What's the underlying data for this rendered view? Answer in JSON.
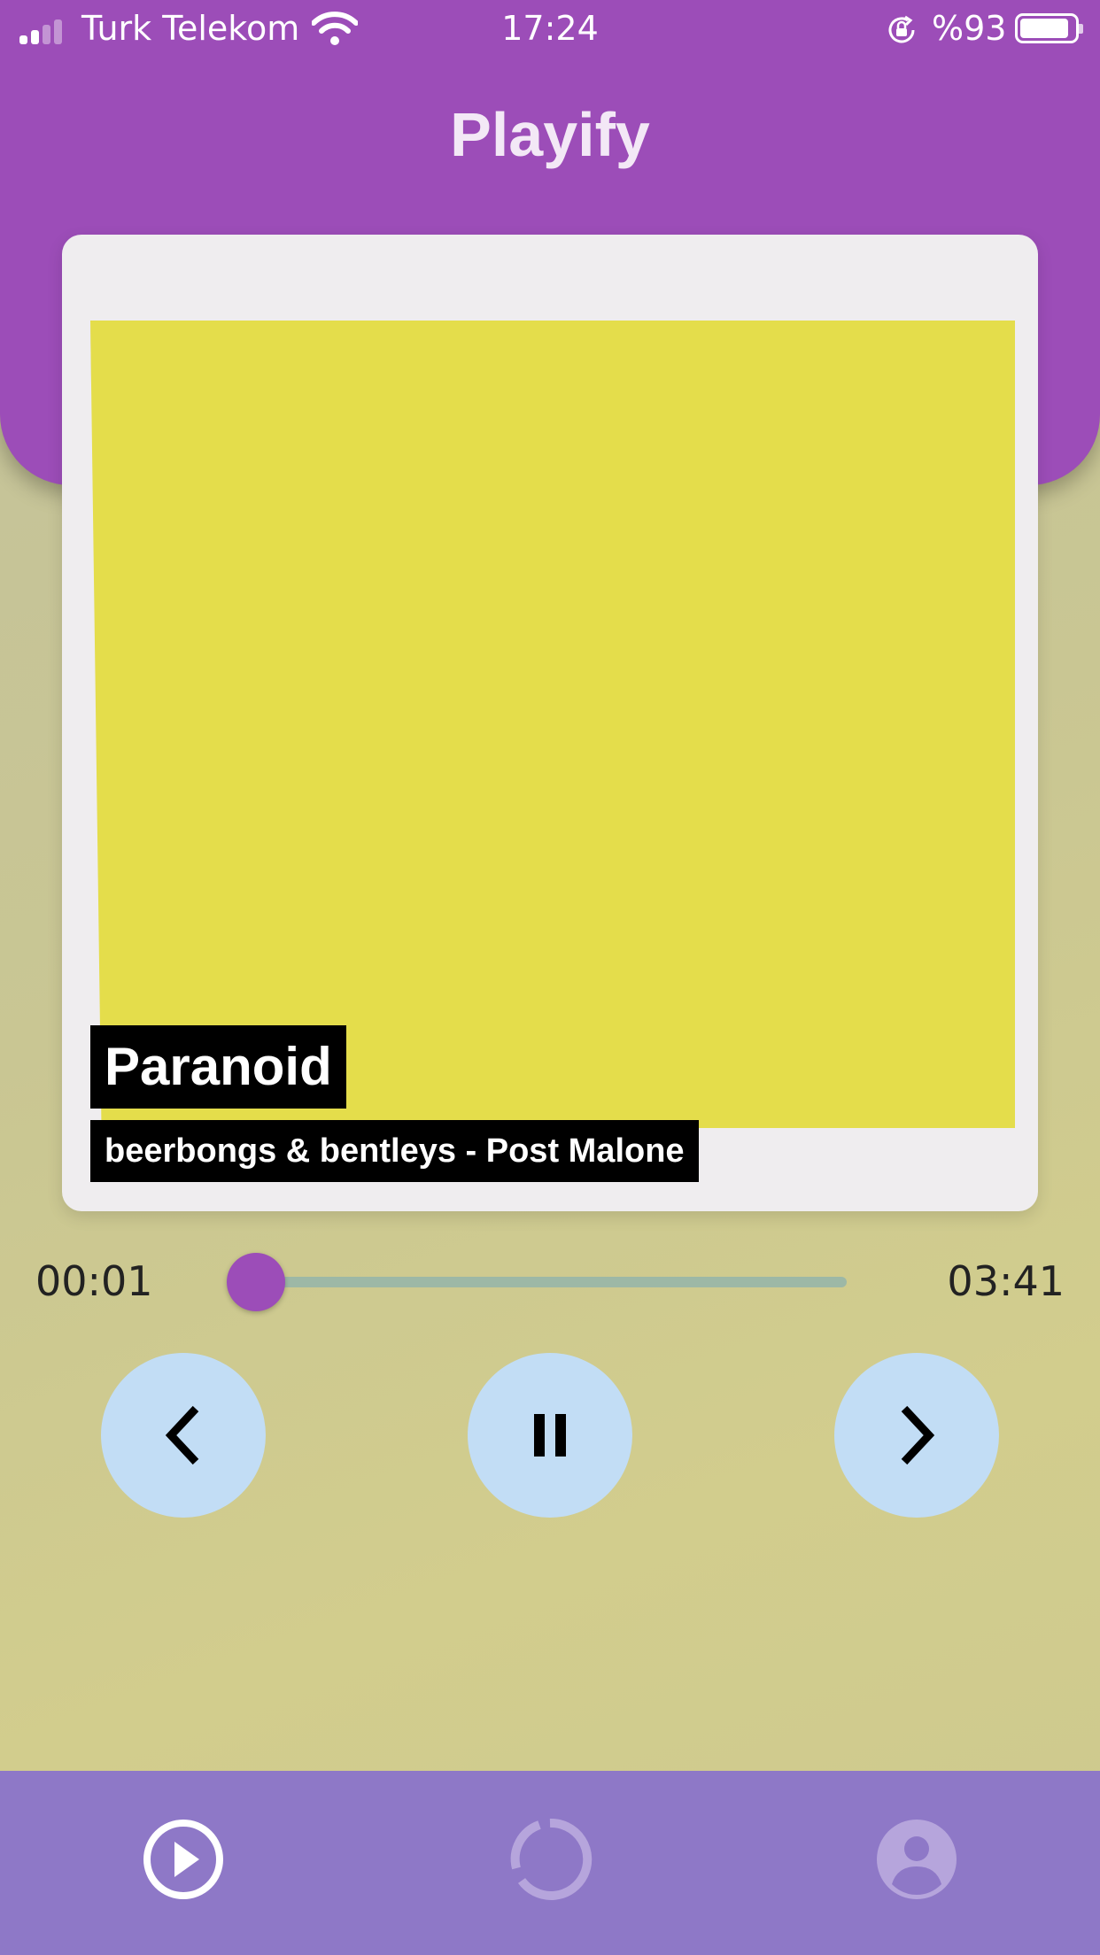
{
  "status_bar": {
    "carrier": "Turk Telekom",
    "time": "17:24",
    "battery_text": "%93",
    "signal_icon": "cellular-signal-icon",
    "wifi_icon": "wifi-icon",
    "orientation_lock_icon": "orientation-lock-icon",
    "battery_icon": "battery-icon",
    "battery_level": 0.93
  },
  "header": {
    "title": "Playify",
    "color": "#9c4db8"
  },
  "now_playing": {
    "title": "Paranoid",
    "subtitle": "beerbongs & bentleys - Post Malone",
    "cover_color": "#e4dd4b"
  },
  "progress": {
    "elapsed": "00:01",
    "duration": "03:41",
    "fraction": 0.005
  },
  "controls": {
    "prev_icon": "chevron-left-icon",
    "pause_icon": "pause-icon",
    "next_icon": "chevron-right-icon"
  },
  "bottom_nav": {
    "items": [
      {
        "icon": "play-circle-icon",
        "active": true
      },
      {
        "icon": "loading-circle-icon",
        "active": false
      },
      {
        "icon": "account-icon",
        "active": false
      }
    ]
  }
}
